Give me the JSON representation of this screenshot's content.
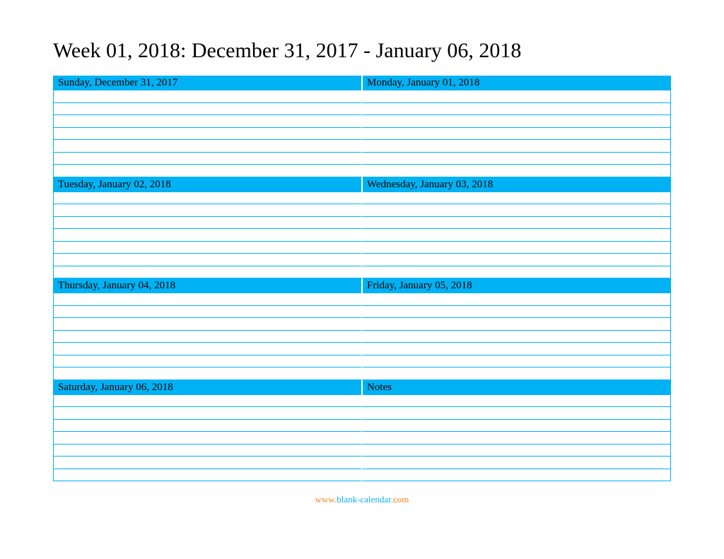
{
  "title": "Week 01, 2018: December 31, 2017 - January 06, 2018",
  "days": [
    {
      "left": "Sunday, December 31, 2017",
      "right": "Monday, January 01, 2018"
    },
    {
      "left": "Tuesday, January 02, 2018",
      "right": "Wednesday, January 03, 2018"
    },
    {
      "left": "Thursday, January 04, 2018",
      "right": "Friday, January 05, 2018"
    },
    {
      "left": "Saturday, January 06, 2018",
      "right": "Notes"
    }
  ],
  "footer": {
    "part1": "www.",
    "part2": "blank-calendar",
    "part3": ".com"
  },
  "linesPerDay": 7
}
